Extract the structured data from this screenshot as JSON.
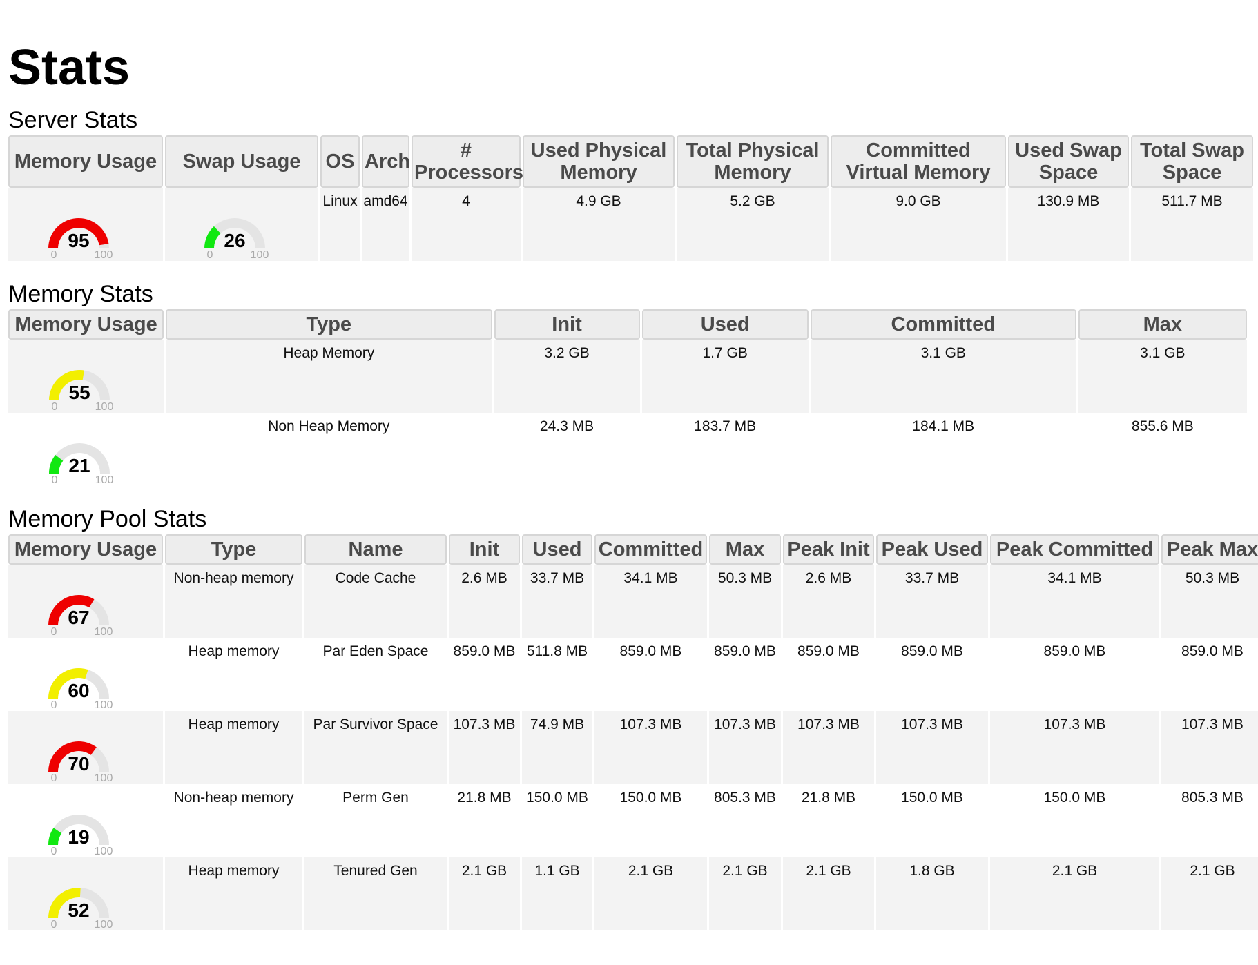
{
  "page_title": "Stats",
  "colors": {
    "red": "#ee0000",
    "yellow": "#f2ef00",
    "green": "#11e811",
    "track": "#e4e4e4"
  },
  "gauge_scale": {
    "min": "0",
    "max": "100"
  },
  "server": {
    "title": "Server Stats",
    "headers": [
      "Memory Usage",
      "Swap Usage",
      "OS",
      "Arch",
      "# Processors",
      "Used Physical Memory",
      "Total Physical Memory",
      "Committed Virtual Memory",
      "Used Swap Space",
      "Total Swap Space"
    ],
    "row": {
      "memory_usage": 95,
      "swap_usage": 26,
      "os": "Linux",
      "arch": "amd64",
      "processors": "4",
      "used_physical": "4.9 GB",
      "total_physical": "5.2 GB",
      "committed_virtual": "9.0 GB",
      "used_swap": "130.9 MB",
      "total_swap": "511.7 MB"
    }
  },
  "memory": {
    "title": "Memory Stats",
    "headers": [
      "Memory Usage",
      "Type",
      "Init",
      "Used",
      "Committed",
      "Max"
    ],
    "rows": [
      {
        "usage": 55,
        "type": "Heap Memory",
        "init": "3.2 GB",
        "used": "1.7 GB",
        "committed": "3.1 GB",
        "max": "3.1 GB"
      },
      {
        "usage": 21,
        "type": "Non Heap Memory",
        "init": "24.3 MB",
        "used": "183.7 MB",
        "committed": "184.1 MB",
        "max": "855.6 MB"
      }
    ]
  },
  "pool": {
    "title": "Memory Pool Stats",
    "headers": [
      "Memory Usage",
      "Type",
      "Name",
      "Init",
      "Used",
      "Committed",
      "Max",
      "Peak Init",
      "Peak Used",
      "Peak Committed",
      "Peak Max"
    ],
    "rows": [
      {
        "usage": 67,
        "type": "Non-heap memory",
        "name": "Code Cache",
        "init": "2.6 MB",
        "used": "33.7 MB",
        "committed": "34.1 MB",
        "max": "50.3 MB",
        "peak_init": "2.6 MB",
        "peak_used": "33.7 MB",
        "peak_committed": "34.1 MB",
        "peak_max": "50.3 MB"
      },
      {
        "usage": 60,
        "type": "Heap memory",
        "name": "Par Eden Space",
        "init": "859.0 MB",
        "used": "511.8 MB",
        "committed": "859.0 MB",
        "max": "859.0 MB",
        "peak_init": "859.0 MB",
        "peak_used": "859.0 MB",
        "peak_committed": "859.0 MB",
        "peak_max": "859.0 MB"
      },
      {
        "usage": 70,
        "type": "Heap memory",
        "name": "Par Survivor Space",
        "init": "107.3 MB",
        "used": "74.9 MB",
        "committed": "107.3 MB",
        "max": "107.3 MB",
        "peak_init": "107.3 MB",
        "peak_used": "107.3 MB",
        "peak_committed": "107.3 MB",
        "peak_max": "107.3 MB"
      },
      {
        "usage": 19,
        "type": "Non-heap memory",
        "name": "Perm Gen",
        "init": "21.8 MB",
        "used": "150.0 MB",
        "committed": "150.0 MB",
        "max": "805.3 MB",
        "peak_init": "21.8 MB",
        "peak_used": "150.0 MB",
        "peak_committed": "150.0 MB",
        "peak_max": "805.3 MB"
      },
      {
        "usage": 52,
        "type": "Heap memory",
        "name": "Tenured Gen",
        "init": "2.1 GB",
        "used": "1.1 GB",
        "committed": "2.1 GB",
        "max": "2.1 GB",
        "peak_init": "2.1 GB",
        "peak_used": "1.8 GB",
        "peak_committed": "2.1 GB",
        "peak_max": "2.1 GB"
      }
    ]
  }
}
